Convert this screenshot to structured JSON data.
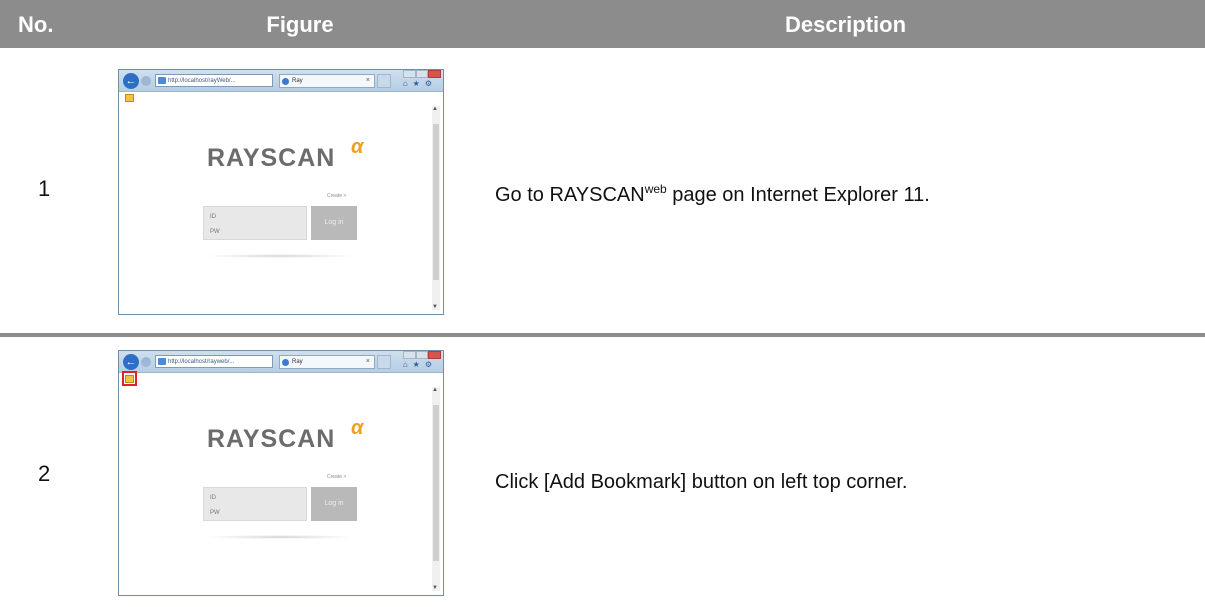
{
  "header": {
    "no": "No.",
    "figure": "Figure",
    "description": "Description"
  },
  "rows": [
    {
      "number": "1",
      "desc_before": "Go to RAYSCAN",
      "desc_sup": "web",
      "desc_after": " page on Internet Explorer 11.",
      "browser": {
        "address": "http://localhost/rayWeb/...",
        "tab_title": "Ray",
        "logo_text": "RAYSCAN",
        "logo_mark": "α",
        "id_label": "ID",
        "pw_label": "PW",
        "login_label": "Log in",
        "small_link": "Create >",
        "bookmark_highlighted": false
      }
    },
    {
      "number": "2",
      "desc_before": "Click [Add Bookmark] button on left top corner.",
      "desc_sup": "",
      "desc_after": "",
      "browser": {
        "address": "http://localhost/rayweb/...",
        "tab_title": "Ray",
        "logo_text": "RAYSCAN",
        "logo_mark": "α",
        "id_label": "ID",
        "pw_label": "PW",
        "login_label": "Log in",
        "small_link": "Create >",
        "bookmark_highlighted": true
      }
    }
  ],
  "colors": {
    "header_bg": "#8c8c8c",
    "highlight": "#e0202a",
    "accent": "#f0a020"
  }
}
